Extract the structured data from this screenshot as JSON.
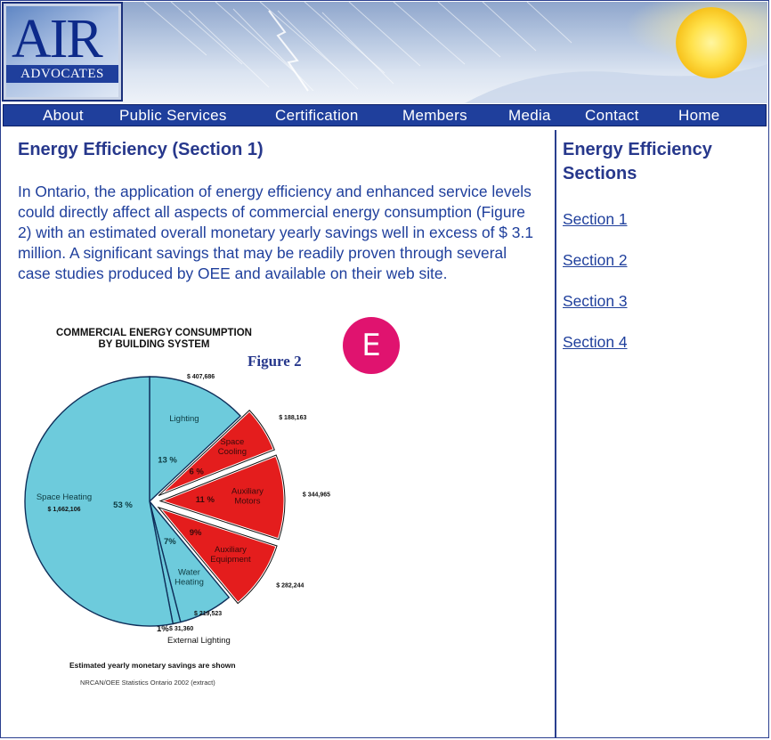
{
  "site": {
    "logo_main": "AIR",
    "logo_sub": "ADVOCATES"
  },
  "nav": {
    "items": [
      "About",
      "Public Services",
      "Certification",
      "Members",
      "Media",
      "Contact",
      "Home"
    ]
  },
  "main": {
    "title": "Energy Efficiency (Section 1)",
    "intro": "In Ontario, the application of energy efficiency and enhanced service levels could directly affect all aspects of commercial energy consumption (Figure 2) with an estimated overall monetary yearly savings well in excess of $ 3.1 million. A significant savings that may be readily proven through several case studies produced by OEE and available on their web site.",
    "badge": "E"
  },
  "sidebar": {
    "title": "Energy Efficiency Sections",
    "links": [
      "Section 1",
      "Section 2",
      "Section 3",
      "Section 4"
    ]
  },
  "colors": {
    "navy": "#1f3f9c",
    "heading": "#27388c",
    "badge": "#e0136f",
    "pie_blue": "#6dcbdc",
    "pie_red": "#e41d1d"
  },
  "chart_data": {
    "type": "pie",
    "title_line1": "COMMERCIAL ENERGY CONSUMPTION",
    "title_line2": "BY BUILDING SYSTEM",
    "figure_label": "Figure 2",
    "footnote": "Estimated yearly monetary savings are shown",
    "source": "NRCAN/OEE Statistics Ontario 2002 (extract)",
    "slices": [
      {
        "name": "Lighting",
        "percent": 13,
        "pct_label": "13 %",
        "savings": "$ 407,686",
        "color": "#6dcbdc",
        "exploded": false
      },
      {
        "name": "Space Cooling",
        "percent": 6,
        "pct_label": "6 %",
        "savings": "$ 188,163",
        "color": "#e41d1d",
        "exploded": true
      },
      {
        "name": "Auxiliary Motors",
        "percent": 11,
        "pct_label": "11 %",
        "savings": "$ 344,965",
        "color": "#e41d1d",
        "exploded": true
      },
      {
        "name": "Auxiliary Equipment",
        "percent": 9,
        "pct_label": "9%",
        "savings": "$ 282,244",
        "color": "#e41d1d",
        "exploded": true
      },
      {
        "name": "Water Heating",
        "percent": 7,
        "pct_label": "7%",
        "savings": "$ 219,523",
        "color": "#6dcbdc",
        "exploded": false
      },
      {
        "name": "External Lighting",
        "percent": 1,
        "pct_label": "1%",
        "savings": "$ 31,360",
        "color": "#6dcbdc",
        "exploded": false
      },
      {
        "name": "Space Heating",
        "percent": 53,
        "pct_label": "53 %",
        "savings": "$ 1,662,106",
        "color": "#6dcbdc",
        "exploded": false
      }
    ]
  }
}
